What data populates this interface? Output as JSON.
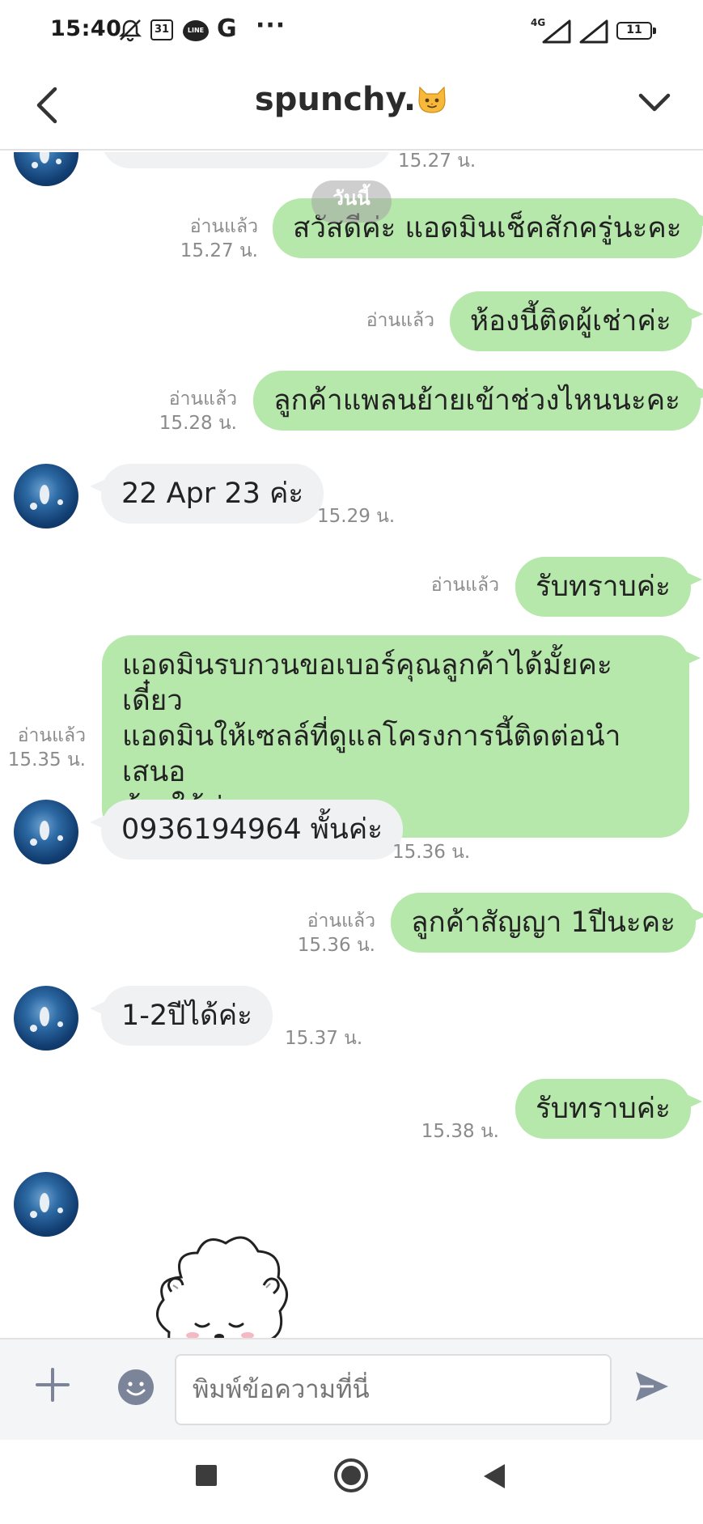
{
  "status_bar": {
    "time": "15:40",
    "calendar_day": "31",
    "line_label": "LINE",
    "google_letter": "G",
    "more": "···",
    "network": "4G",
    "battery": "11"
  },
  "header": {
    "title": "spunchy.",
    "emoji_name": "cat-face-icon",
    "back_icon": "chevron-left-icon",
    "menu_icon": "chevron-down-icon"
  },
  "date_divider": "วันนี้",
  "messages": [
    {
      "side": "in",
      "text": "",
      "time": "15.27 น."
    },
    {
      "side": "out",
      "text": "สวัสดีค่ะ แอดมินเช็คสักครู่นะคะ",
      "read": "อ่านแล้ว",
      "time": "15.27 น."
    },
    {
      "side": "out",
      "text": "ห้องนี้ติดผู้เช่าค่ะ",
      "read": "อ่านแล้ว",
      "time": ""
    },
    {
      "side": "out",
      "text": "ลูกค้าแพลนย้ายเข้าช่วงไหนนะคะ",
      "read": "อ่านแล้ว",
      "time": "15.28 น."
    },
    {
      "side": "in",
      "text": "22 Apr 23 ค่ะ",
      "time": "15.29 น."
    },
    {
      "side": "out",
      "text": "รับทราบค่ะ",
      "read": "อ่านแล้ว",
      "time": ""
    },
    {
      "side": "out",
      "lines": [
        "แอดมินรบกวนขอเบอร์คุณลูกค้าได้มั้ยคะ เดี๋ยว",
        "แอดมินให้เซลล์ที่ดูแลโครงการนี้ติดต่อนำเสนอ",
        "ห้องให้ค่ะ"
      ],
      "read": "อ่านแล้ว",
      "time": "15.35 น."
    },
    {
      "side": "in",
      "text": "0936194964 พั้นค่ะ",
      "time": "15.36 น."
    },
    {
      "side": "out",
      "text": "ลูกค้าสัญญา 1ปีนะคะ",
      "read": "อ่านแล้ว",
      "time": "15.36 น."
    },
    {
      "side": "in",
      "text": "1-2ปีได้ค่ะ",
      "time": "15.37 น."
    },
    {
      "side": "out",
      "text": "รับทราบค่ะ",
      "read": "",
      "time": "15.38 น."
    }
  ],
  "input": {
    "placeholder": "พิมพ์ข้อความที่นี่"
  },
  "colors": {
    "outgoing_bubble": "#b6e7ab",
    "incoming_bubble": "#f0f1f3",
    "meta_text": "#8b8b8b",
    "icon_gray": "#7b8499"
  }
}
